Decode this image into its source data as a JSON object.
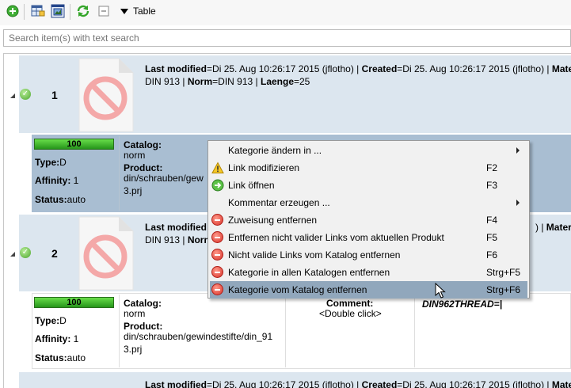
{
  "toolbar": {
    "view_label": "Table",
    "icons": [
      "add-icon",
      "link-grid-icon",
      "picture-icon",
      "refresh-icon",
      "collapse-icon"
    ]
  },
  "search": {
    "placeholder": "Search item(s) with text search"
  },
  "rows": [
    {
      "number": "1",
      "line1_parts": [
        "Last modified",
        "=Di 25. Aug 10:26:17 2015 (jflotho) | ",
        "Created",
        "=Di 25. Aug 10:26:17 2015 (jflotho) | ",
        "Materi"
      ],
      "line2_parts": [
        "DIN 913 | ",
        "Norm",
        "=DIN 913 | ",
        "Laenge",
        "=25"
      ],
      "detail": {
        "progress": 100,
        "progress_label": "100",
        "type_label": "Type:",
        "type_value": "D",
        "affinity_label": "Affinity:",
        "affinity_value": "1",
        "status_label": "Status:",
        "status_value": "auto",
        "catalog_label": "Catalog:",
        "catalog_value": "norm",
        "product_label": "Product:",
        "product_line1": "din/schrauben/gew",
        "product_line2": "3.prj"
      }
    },
    {
      "number": "2",
      "line1_parts": [
        "Last modified",
        "",
        ") | ",
        "Materi"
      ],
      "line2_parts": [
        "DIN 913 | ",
        "Norm"
      ],
      "detail": {
        "progress": 100,
        "progress_label": "100",
        "type_label": "Type:",
        "type_value": "D",
        "affinity_label": "Affinity:",
        "affinity_value": "1",
        "status_label": "Status:",
        "status_value": "auto",
        "catalog_label": "Catalog:",
        "catalog_value": "norm",
        "product_label": "Product:",
        "product_line1": "din/schrauben/gewindestifte/din_91",
        "product_line2": "3.prj",
        "comment_label": "Comment:",
        "comment_value": "<Double click>",
        "attr_text": "DIN962THREAD=|"
      }
    },
    {
      "line1_parts": [
        "Last modified",
        "=Di 25. Aug 10:26:17 2015 (jflotho) | ",
        "Created",
        "=Di 25. Aug 10:26:17 2015 (jflotho) | ",
        "Materi"
      ]
    }
  ],
  "context_menu": {
    "items": [
      {
        "label": "Kategorie ändern in ...",
        "shortcut": "",
        "icon": "",
        "submenu": true
      },
      {
        "label": "Link modifizieren",
        "shortcut": "F2",
        "icon": "warning-icon",
        "submenu": false
      },
      {
        "label": "Link öffnen",
        "shortcut": "F3",
        "icon": "open-link-icon",
        "submenu": false
      },
      {
        "label": "Kommentar erzeugen ...",
        "shortcut": "",
        "icon": "",
        "submenu": true
      },
      {
        "label": "Zuweisung entfernen",
        "shortcut": "F4",
        "icon": "remove-icon",
        "submenu": false
      },
      {
        "label": "Entfernen nicht valider Links vom aktuellen Produkt",
        "shortcut": "F5",
        "icon": "remove-icon",
        "submenu": false
      },
      {
        "label": "Nicht valide Links vom Katalog entfernen",
        "shortcut": "F6",
        "icon": "remove-icon",
        "submenu": false
      },
      {
        "label": "Kategorie in allen Katalogen entfernen",
        "shortcut": "Strg+F5",
        "icon": "remove-icon",
        "submenu": false
      },
      {
        "label": "Kategorie vom Katalog entfernen",
        "shortcut": "Strg+F6",
        "icon": "remove-icon",
        "submenu": false,
        "highlighted": true
      }
    ]
  },
  "colors": {
    "row_header_bg": "#dce6ef",
    "row_selected_bg": "#a9bed2",
    "progress_green": "#3cb52a",
    "menu_highlight": "#91a7bc",
    "remove_red": "#d9322a"
  }
}
